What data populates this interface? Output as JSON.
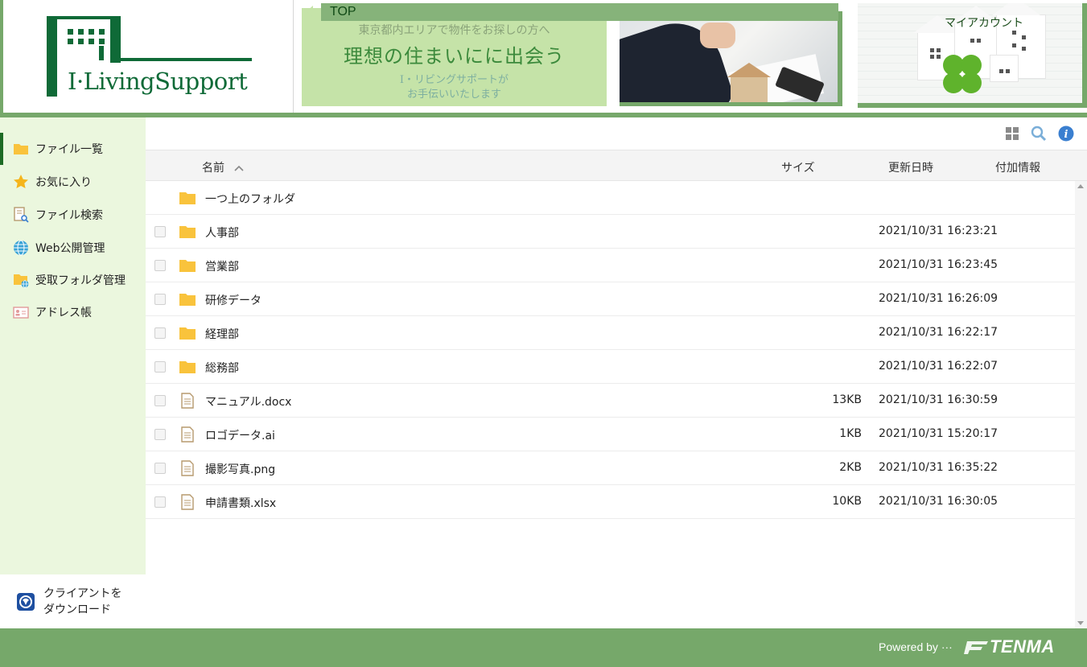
{
  "header": {
    "logo_text": "I·LivingSupport",
    "top_label": "TOP",
    "banner": {
      "line1": "東京都内エリアで物件をお探しの方へ",
      "line2": "理想の住まいにに出会う",
      "line3": "I・リビングサポートが",
      "line4": "お手伝いいたします"
    },
    "my_account": "マイアカウント"
  },
  "sidebar": {
    "items": [
      {
        "label": "ファイル一覧",
        "icon": "folder-icon"
      },
      {
        "label": "お気に入り",
        "icon": "star-icon"
      },
      {
        "label": "ファイル検索",
        "icon": "file-search-icon"
      },
      {
        "label": "Web公開管理",
        "icon": "globe-icon"
      },
      {
        "label": "受取フォルダ管理",
        "icon": "receive-folder-icon"
      },
      {
        "label": "アドレス帳",
        "icon": "address-book-icon"
      }
    ],
    "download": {
      "line1": "クライアントを",
      "line2": "ダウンロード"
    }
  },
  "list": {
    "columns": {
      "name": "名前",
      "size": "サイズ",
      "updated": "更新日時",
      "extra": "付加情報"
    },
    "parent_folder": "一つ上のフォルダ",
    "rows": [
      {
        "name": "人事部",
        "type": "folder",
        "size": "",
        "date": "2021/10/31 16:23:21"
      },
      {
        "name": "営業部",
        "type": "folder",
        "size": "",
        "date": "2021/10/31 16:23:45"
      },
      {
        "name": "研修データ",
        "type": "folder",
        "size": "",
        "date": "2021/10/31 16:26:09"
      },
      {
        "name": "経理部",
        "type": "folder",
        "size": "",
        "date": "2021/10/31 16:22:17"
      },
      {
        "name": "総務部",
        "type": "folder",
        "size": "",
        "date": "2021/10/31 16:22:07"
      },
      {
        "name": "マニュアル.docx",
        "type": "file",
        "size": "13KB",
        "date": "2021/10/31 16:30:59"
      },
      {
        "name": "ロゴデータ.ai",
        "type": "file",
        "size": "1KB",
        "date": "2021/10/31 15:20:17"
      },
      {
        "name": "撮影写真.png",
        "type": "file",
        "size": "2KB",
        "date": "2021/10/31 16:35:22"
      },
      {
        "name": "申請書類.xlsx",
        "type": "file",
        "size": "10KB",
        "date": "2021/10/31 16:30:05"
      }
    ]
  },
  "footer": {
    "powered": "Powered by ···",
    "brand": "TENMA"
  },
  "colors": {
    "accent": "#76a86a",
    "sidebar_bg": "#ebf7de",
    "folder": "#f9c33c",
    "logo": "#0f6a37"
  }
}
